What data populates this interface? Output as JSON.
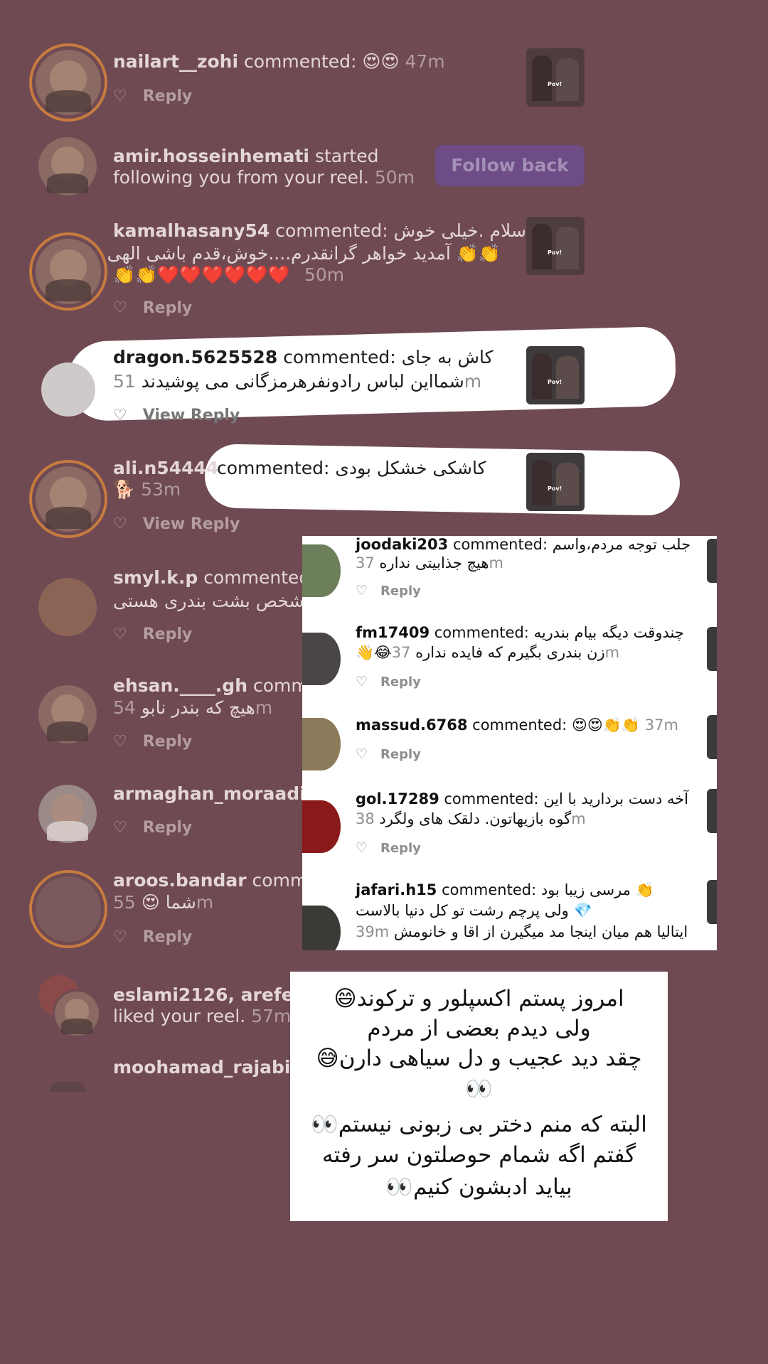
{
  "notifications": [
    {
      "user": "nailart__zohi",
      "text": "commented:",
      "emoji": "😍😍",
      "time": "47m",
      "reply": "Reply"
    },
    {
      "user": "amir.hosseinhemati",
      "text": "started",
      "text2": "following you from your reel.",
      "time": "50m",
      "button": "Follow back"
    },
    {
      "user": "kamalhasany54",
      "text": "commented:",
      "comment1": "سلام .خیلی خوش",
      "comment2": "👏👏 آمدید خواهر گرانقدرم....خوش،قدم باشی الهی",
      "comment3": "👏👏❤️❤️❤️❤️❤️❤️",
      "time": "50m",
      "reply": "Reply"
    },
    {
      "user": "dragon.5625528",
      "text": "commented:",
      "comment1": "کاش به جای",
      "comment2": "شمااین لباس رادونفرهرمزگانی می پوشیدند",
      "time": "51m",
      "reply": "View Reply"
    },
    {
      "user": "ali.n54444",
      "text": "commented:",
      "comment1": "کاشکی خشکل بودی",
      "emoji": "🐕",
      "time": "53m",
      "reply": "View Reply"
    },
    {
      "user": "smyl.k.p",
      "text": "commented:",
      "comment1": "شخص بشت بندری هستی",
      "reply": "Reply"
    },
    {
      "user": "ehsan.____.gh",
      "text": "comme",
      "comment1": "هیچ که بندر نابو",
      "time": "54m",
      "reply": "Reply"
    },
    {
      "user": "armaghan_moraadi",
      "text": "c",
      "reply": "Reply"
    },
    {
      "user": "aroos.bandar",
      "text": "comme",
      "comment1": "شما",
      "emoji": "😍",
      "time": "55m",
      "reply": "Reply"
    },
    {
      "user": "eslami2126, arefeh_",
      "text": "liked your reel.",
      "time": "57m"
    },
    {
      "user": "moohamad_rajabi",
      "text": "c"
    }
  ],
  "thumb_tag": "Pov!",
  "screenshot": {
    "rows": [
      {
        "user": "joodaki203",
        "text": "commented:",
        "comment1": "جلب توجه مردم،واسم",
        "comment2": "هیچ جذابیتی نداره",
        "time": "37m",
        "reply": "Reply"
      },
      {
        "user": "fm17409",
        "text": "commented:",
        "comment1": "چندوقت دیگه بیام بندریه",
        "comment2": "👋😂زن بندری بگیرم که فایده نداره",
        "time": "37m",
        "reply": "Reply"
      },
      {
        "user": "massud.6768",
        "text": "commented:",
        "comment1": "😍😍👏👏",
        "time": "37m",
        "reply": "Reply"
      },
      {
        "user": "gol.17289",
        "text": "commented:",
        "comment1": "آخه دست بردارید با این",
        "comment2": "گوه بازیهاتون. دلقک های ولگرد",
        "time": "38m",
        "reply": "Reply"
      },
      {
        "user": "jafari.h15",
        "text": "commented:",
        "comment1": "مرسی زیبا بود 👏",
        "comment2": "ولی پرچم رشت تو کل دنیا بالاست 💎",
        "comment3": "ایتالیا هم میان اینجا مد میگیرن از اقا و خانومش",
        "time": "39m"
      }
    ]
  },
  "card_lines": [
    "امروز پستم اکسپلور و ترکوند😄",
    "ولی دیدم بعضی از مردم",
    "چقد دید عجیب و دل سیاهی دارن😅",
    "👀",
    "البته که منم دختر بی زبونی نیستم👀",
    "گفتم اگه شمام حوصلتون سر رفته",
    "بیاید ادبشون کنیم👀"
  ],
  "icons": {
    "heart": "heart-icon"
  },
  "colors": {
    "background": "#6f4a52",
    "follow_button": "#6e4d86",
    "story_ring": "#c77b3f"
  }
}
